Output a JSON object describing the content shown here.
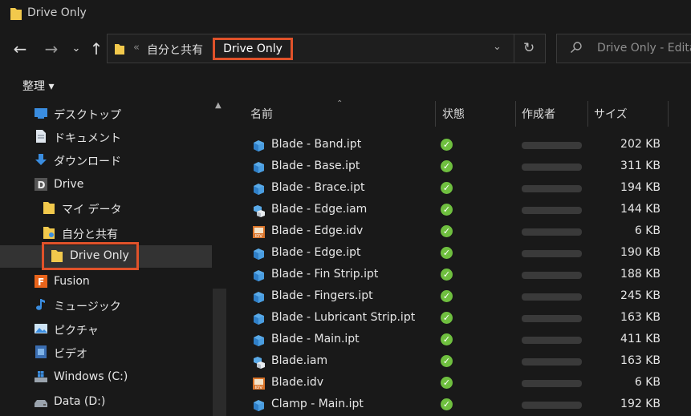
{
  "window": {
    "title": "Drive Only"
  },
  "address": {
    "breadcrumb_sep": "«",
    "crumbs": [
      "自分と共有",
      "Drive Only"
    ]
  },
  "search": {
    "placeholder": "Drive Only - Edita"
  },
  "commandbar": {
    "organize": "整理 ▾"
  },
  "sidebar": {
    "items": [
      {
        "label": "デスクトップ"
      },
      {
        "label": "ドキュメント"
      },
      {
        "label": "ダウンロード"
      },
      {
        "label": "Drive"
      },
      {
        "label": "マイ データ"
      },
      {
        "label": "自分と共有"
      },
      {
        "label": "Drive Only"
      },
      {
        "label": "Fusion"
      },
      {
        "label": "ミュージック"
      },
      {
        "label": "ピクチャ"
      },
      {
        "label": "ビデオ"
      },
      {
        "label": "Windows (C:)"
      },
      {
        "label": "Data (D:)"
      }
    ]
  },
  "columns": {
    "name": "名前",
    "status": "状態",
    "author": "作成者",
    "size": "サイズ"
  },
  "files": [
    {
      "name": "Blade - Band.ipt",
      "size": "202 KB",
      "type": "ipt"
    },
    {
      "name": "Blade - Base.ipt",
      "size": "311 KB",
      "type": "ipt"
    },
    {
      "name": "Blade - Brace.ipt",
      "size": "194 KB",
      "type": "ipt"
    },
    {
      "name": "Blade - Edge.iam",
      "size": "144 KB",
      "type": "iam"
    },
    {
      "name": "Blade - Edge.idv",
      "size": "6 KB",
      "type": "idv"
    },
    {
      "name": "Blade - Edge.ipt",
      "size": "190 KB",
      "type": "ipt"
    },
    {
      "name": "Blade - Fin Strip.ipt",
      "size": "188 KB",
      "type": "ipt"
    },
    {
      "name": "Blade - Fingers.ipt",
      "size": "245 KB",
      "type": "ipt"
    },
    {
      "name": "Blade - Lubricant Strip.ipt",
      "size": "163 KB",
      "type": "ipt"
    },
    {
      "name": "Blade - Main.ipt",
      "size": "411 KB",
      "type": "ipt"
    },
    {
      "name": "Blade.iam",
      "size": "163 KB",
      "type": "iam"
    },
    {
      "name": "Blade.idv",
      "size": "6 KB",
      "type": "idv"
    },
    {
      "name": "Clamp - Main.ipt",
      "size": "192 KB",
      "type": "ipt"
    }
  ],
  "colors": {
    "highlight": "#e0522a",
    "status_ok": "#6fbf3f",
    "folder": "#f2c94c",
    "part": "#4a9de0"
  }
}
